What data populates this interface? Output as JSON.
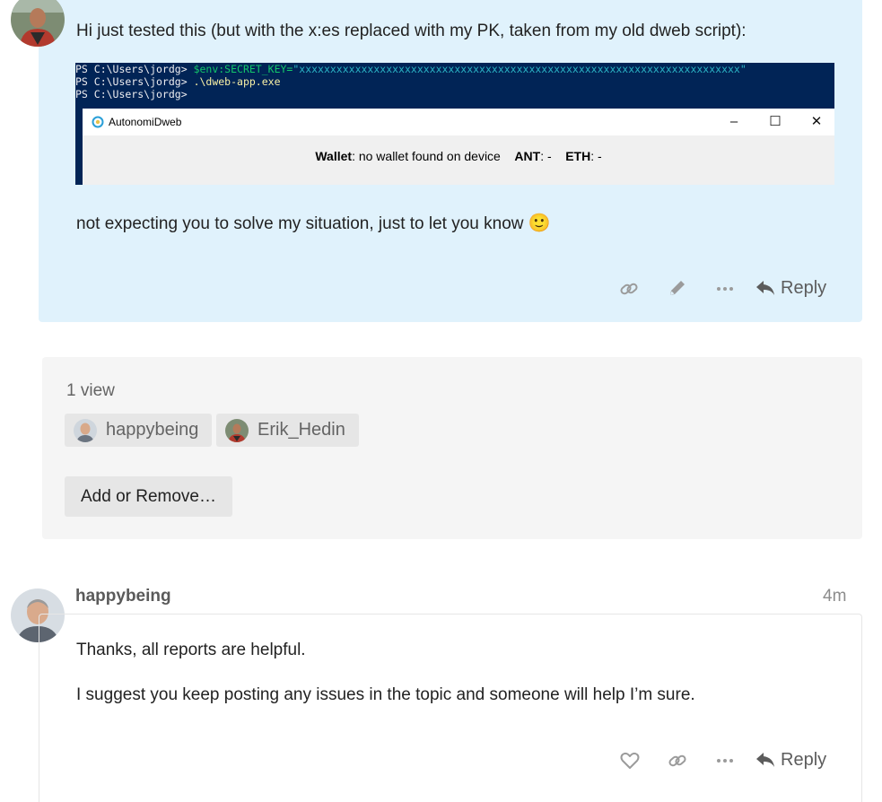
{
  "post1": {
    "text": "Hi just tested this (but with the x:es replaced with my PK, taken from my old dweb script):",
    "followup": "not expecting you to solve my situation, just to let you know",
    "emoji": "🙂",
    "embed": {
      "ps_prompt": "PS C:\\Users\\jordg> ",
      "ps_line1_cmd": "$env:SECRET_KEY=",
      "ps_line1_value": "\"xxxxxxxxxxxxxxxxxxxxxxxxxxxxxxxxxxxxxxxxxxxxxxxxxxxxxxxxxxxxxxxxxxxxxxx\"",
      "ps_line2_cmd": ".\\dweb-app.exe",
      "window_title": "AutonomiDweb",
      "window_min": "–",
      "window_max": "☐",
      "window_close": "✕",
      "wallet_label": "Wallet",
      "wallet_text": ": no wallet found on device",
      "ant_label": "ANT",
      "ant_value": ": -",
      "eth_label": "ETH",
      "eth_value": ": -"
    },
    "actions": {
      "link_icon": "link-icon",
      "edit_icon": "pencil-icon",
      "more_icon": "ellipsis-icon",
      "reply_label": "Reply"
    }
  },
  "views": {
    "count_label": "1 view",
    "users": [
      "happybeing",
      "Erik_Hedin"
    ],
    "add_remove_label": "Add or Remove…"
  },
  "post2": {
    "username": "happybeing",
    "time": "4m",
    "paragraphs": [
      "Thanks, all reports are helpful.",
      "I suggest you keep posting any issues in the topic and someone will help I’m sure."
    ],
    "actions": {
      "like_icon": "heart-icon",
      "link_icon": "link-icon",
      "more_icon": "ellipsis-icon",
      "reply_label": "Reply"
    }
  },
  "colors": {
    "highlight_bg": "#e0f2fc",
    "views_bg": "#f5f5f5",
    "chip_bg": "#e6e6e6",
    "powershell_bg": "#012456"
  }
}
